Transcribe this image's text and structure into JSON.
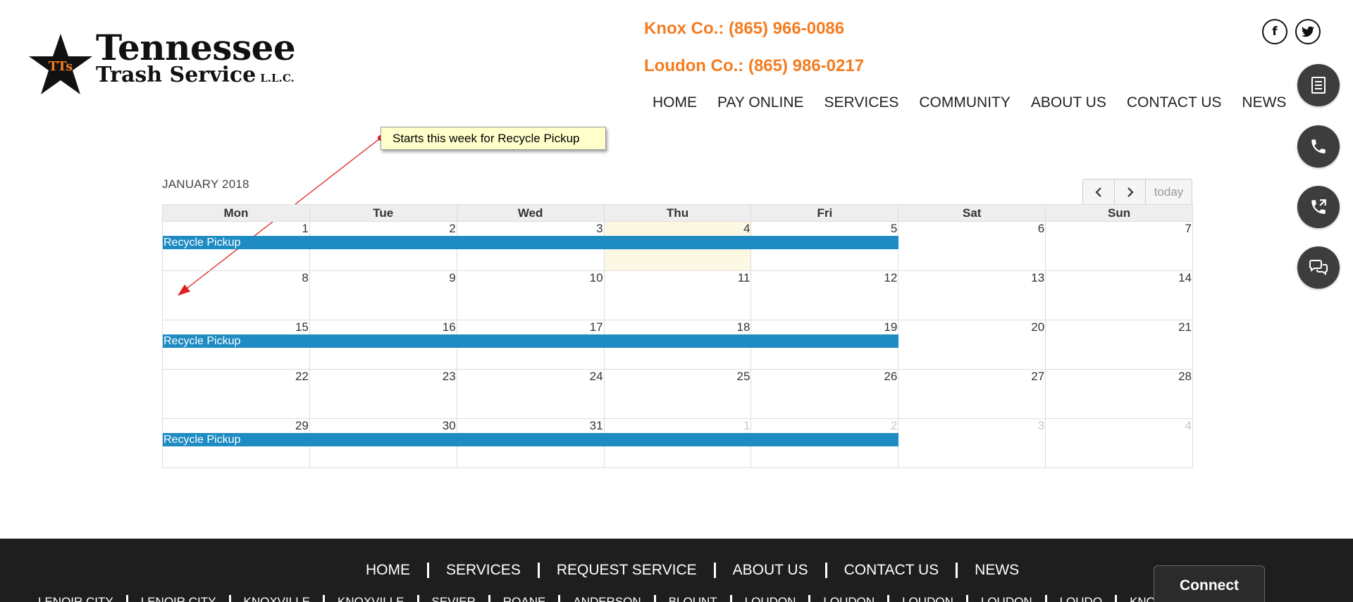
{
  "brand": {
    "name_line1": "Tennessee",
    "name_line2": "Trash Service",
    "suffix": "L.L.C.",
    "emblem_text": "TTs"
  },
  "header": {
    "phone1": "Knox Co.: (865) 966-0086",
    "phone2": "Loudon Co.: (865) 986-0217",
    "social": [
      "facebook-icon",
      "twitter-icon"
    ],
    "nav": [
      "HOME",
      "PAY ONLINE",
      "SERVICES",
      "COMMUNITY",
      "ABOUT US",
      "CONTACT US",
      "NEWS"
    ]
  },
  "side_buttons": [
    "document-icon",
    "phone-icon",
    "phone-forward-icon",
    "chat-icon"
  ],
  "annotation": {
    "text": "Starts this week for Recycle Pickup"
  },
  "calendar": {
    "title": "JANUARY 2018",
    "today_label": "today",
    "days": [
      "Mon",
      "Tue",
      "Wed",
      "Thu",
      "Fri",
      "Sat",
      "Sun"
    ],
    "weeks": [
      {
        "dates": [
          "1",
          "2",
          "3",
          "4",
          "5",
          "6",
          "7"
        ],
        "event": "Recycle Pickup"
      },
      {
        "dates": [
          "8",
          "9",
          "10",
          "11",
          "12",
          "13",
          "14"
        ],
        "event": ""
      },
      {
        "dates": [
          "15",
          "16",
          "17",
          "18",
          "19",
          "20",
          "21"
        ],
        "event": "Recycle Pickup"
      },
      {
        "dates": [
          "22",
          "23",
          "24",
          "25",
          "26",
          "27",
          "28"
        ],
        "event": ""
      },
      {
        "dates": [
          "29",
          "30",
          "31",
          "1",
          "2",
          "3",
          "4"
        ],
        "event": "Recycle Pickup"
      }
    ],
    "today_highlight": "4",
    "event_color": "#1e8bc3",
    "today_color": "#fcf8e3"
  },
  "footer": {
    "nav": [
      "HOME",
      "SERVICES",
      "REQUEST SERVICE",
      "ABOUT US",
      "CONTACT US",
      "NEWS"
    ],
    "cities": [
      "LENOIR CITY",
      "LENOIR CITY",
      "KNOXVILLE",
      "KNOXVILLE",
      "SEVIER",
      "ROANE",
      "ANDERSON",
      "BLOUNT",
      "LOUDON",
      "LOUDON",
      "LOUDON",
      "LOUDON",
      "LOUDO",
      "KNOX"
    ],
    "connect": "Connect"
  },
  "colors": {
    "accent": "#f47c20",
    "footer_bg": "#1e1e1e"
  }
}
